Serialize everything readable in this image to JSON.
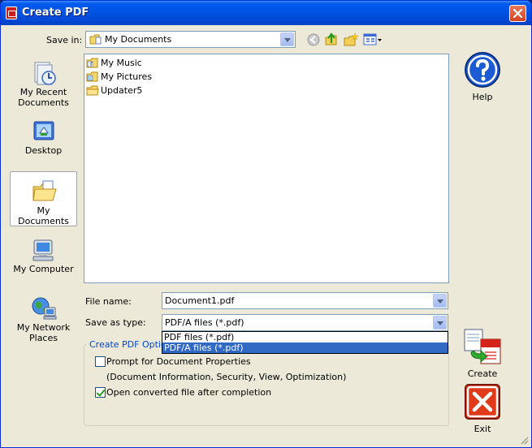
{
  "window": {
    "title": "Create PDF"
  },
  "toolbar": {
    "save_in_label": "Save in:",
    "save_in_value": "My Documents",
    "icons": [
      "back-icon",
      "up-folder-icon",
      "new-folder-icon",
      "view-menu-icon"
    ]
  },
  "places": [
    {
      "label": "My Recent Documents",
      "icon": "recent-documents-icon",
      "active": false
    },
    {
      "label": "Desktop",
      "icon": "desktop-icon",
      "active": false
    },
    {
      "label": "My Documents",
      "icon": "my-documents-icon",
      "active": true
    },
    {
      "label": "My Computer",
      "icon": "my-computer-icon",
      "active": false
    },
    {
      "label": "My Network Places",
      "icon": "network-places-icon",
      "active": false
    }
  ],
  "files": [
    {
      "name": "My Music",
      "icon": "music-folder-icon"
    },
    {
      "name": "My Pictures",
      "icon": "pictures-folder-icon"
    },
    {
      "name": "Updater5",
      "icon": "folder-icon"
    }
  ],
  "form": {
    "file_name_label": "File name:",
    "file_name_value": "Document1.pdf",
    "save_as_label": "Save as type:",
    "save_as_value": "PDF/A files (*.pdf)",
    "save_as_options": [
      "PDF files (*.pdf)",
      "PDF/A files (*.pdf)"
    ],
    "save_as_selected_index": 1
  },
  "options": {
    "legend": "Create PDF Options",
    "prompt_label": "Prompt for Document Properties",
    "prompt_checked": false,
    "prompt_note": "(Document Information, Security, View, Optimization)",
    "open_label": "Open converted file after completion",
    "open_checked": true
  },
  "buttons": {
    "help_label": "Help",
    "create_label": "Create",
    "exit_label": "Exit"
  },
  "colors": {
    "title_bar": "#0054e3",
    "selection": "#316ac5",
    "group_legend": "#0046d5",
    "exit_red": "#e03a1a"
  }
}
